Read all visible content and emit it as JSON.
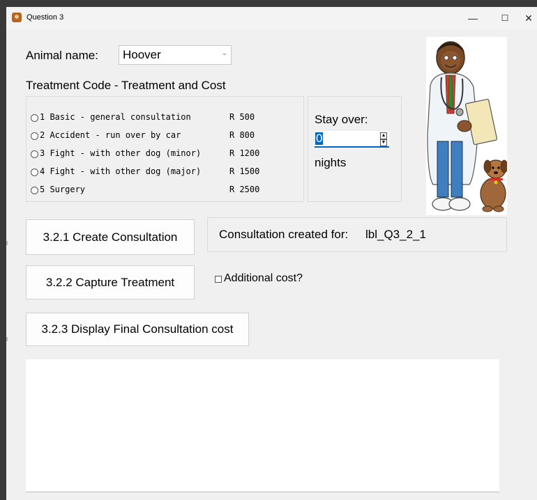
{
  "window": {
    "title": "Question 3",
    "controls": {
      "minimize": "—",
      "maximize": "☐",
      "close": "✕"
    }
  },
  "animal": {
    "label": "Animal name:",
    "selected": "Hoover"
  },
  "treatment": {
    "heading": "Treatment Code - Treatment and Cost",
    "options": [
      {
        "label": "1 Basic - general consultation",
        "cost": "R 500"
      },
      {
        "label": "2 Accident - run over by car",
        "cost": "R 800"
      },
      {
        "label": "3 Fight - with other dog (minor)",
        "cost": "R 1200"
      },
      {
        "label": "4 Fight - with other dog (major)",
        "cost": "R 1500"
      },
      {
        "label": "5 Surgery",
        "cost": "R 2500"
      }
    ]
  },
  "stay": {
    "label": "Stay over:",
    "value": "0",
    "unit": "nights"
  },
  "buttons": {
    "create": "3.2.1 Create Consultation",
    "capture": "3.2.2 Capture Treatment",
    "display": "3.2.3 Display Final Consultation cost"
  },
  "status": {
    "text": "Consultation created for:",
    "value": "lbl_Q3_2_1"
  },
  "additional": {
    "label": "Additional cost?"
  },
  "output": {
    "text": ""
  },
  "icons": {
    "app": "vet-app-icon",
    "picture": "vet-with-dog-illustration"
  },
  "colors": {
    "accent": "#0067c0",
    "window_bg": "#f0f0f0"
  }
}
